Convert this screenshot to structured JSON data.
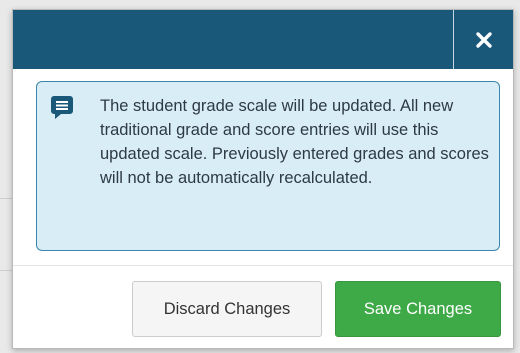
{
  "dialog": {
    "close_icon": "close-icon",
    "header_color": "#1a587a"
  },
  "alert": {
    "icon": "message-icon",
    "message": "The student grade scale will be updated. All new traditional grade and score entries will use this updated scale. Previously entered grades and scores will not be automatically recalculated.",
    "background_color": "#d9edf7",
    "border_color": "#3a87ad"
  },
  "footer": {
    "discard_label": "Discard Changes",
    "save_label": "Save Changes",
    "save_color": "#3ea947"
  }
}
